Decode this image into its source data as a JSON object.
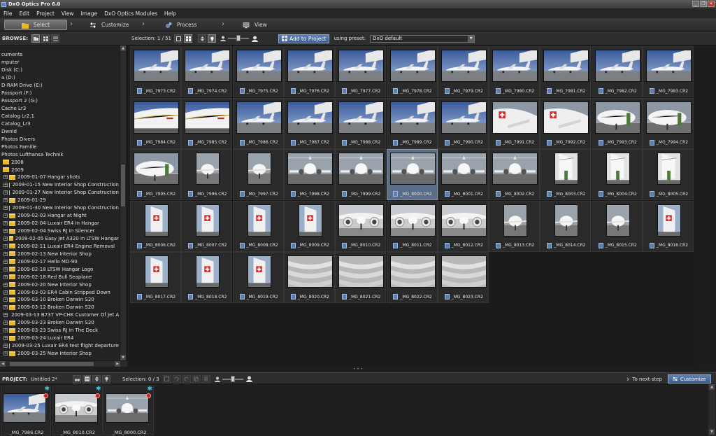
{
  "window": {
    "title": "DxO Optics Pro 6.0"
  },
  "menu": [
    "File",
    "Edit",
    "Project",
    "View",
    "Image",
    "DxO Optics Modules",
    "Help"
  ],
  "steps": [
    {
      "label": "Select",
      "icon": "folder-icon"
    },
    {
      "label": "Customize",
      "icon": "sliders-icon"
    },
    {
      "label": "Process",
      "icon": "gears-icon"
    },
    {
      "label": "View",
      "icon": "monitor-icon"
    }
  ],
  "toolbar": {
    "browse_label": "BROWSE:",
    "selection": "Selection: 1 / 51",
    "add_button": "Add to Project",
    "preset_label": "using preset:",
    "preset_value": "DxO default"
  },
  "browser": {
    "nodes": [
      {
        "label": "cuments",
        "type": "text"
      },
      {
        "label": "mputer",
        "type": "text"
      },
      {
        "label": "Disk (C:)",
        "type": "text"
      },
      {
        "label": "a (D:)",
        "type": "text"
      },
      {
        "label": "D-RAM Drive (E:)",
        "type": "text"
      },
      {
        "label": "Passport (F:)",
        "type": "text"
      },
      {
        "label": "Passport 2 (G:)",
        "type": "text"
      },
      {
        "label": "Cache Lr3",
        "type": "text"
      },
      {
        "label": "Catalog Lr2.1",
        "type": "text"
      },
      {
        "label": "Catalog_Lr3",
        "type": "text"
      },
      {
        "label": "Dwnld",
        "type": "text"
      },
      {
        "label": "Photos Divers",
        "type": "text"
      },
      {
        "label": "Photos Famille",
        "type": "text"
      },
      {
        "label": "Photos Lufthansa Technik",
        "type": "text"
      },
      {
        "label": "2008",
        "type": "folder"
      },
      {
        "label": "2009",
        "type": "folder"
      },
      {
        "label": "2009-01-07 Hangar shots",
        "type": "sub"
      },
      {
        "label": "2009-01-15 New Interior Shop Construction",
        "type": "sub"
      },
      {
        "label": "2009-01-27 New Interior Shop Construction",
        "type": "sub"
      },
      {
        "label": "2009-01-29",
        "type": "sub"
      },
      {
        "label": "2009-01-30 New Interior Shop Construction",
        "type": "sub"
      },
      {
        "label": "2009-02-03 Hangar at Night",
        "type": "sub"
      },
      {
        "label": "2009-02-04 Luxair ER4 In Hangar",
        "type": "sub"
      },
      {
        "label": "2009-02-04 Swiss RJ In Silencer",
        "type": "sub"
      },
      {
        "label": "2009-02-05 Easy Jet A320 in LTSW Hangar",
        "type": "sub"
      },
      {
        "label": "2009-02-11 Luxair ER4 Engine Removal",
        "type": "sub"
      },
      {
        "label": "2009-02-13 New Interior Shop",
        "type": "sub"
      },
      {
        "label": "2009-02-17 Hello MD-90",
        "type": "sub"
      },
      {
        "label": "2009-02-18 LTSW Hangar Logo",
        "type": "sub"
      },
      {
        "label": "2009-02-18 Red Bull Seaplane",
        "type": "sub"
      },
      {
        "label": "2009-02-20 New Interior Shop",
        "type": "sub"
      },
      {
        "label": "2009-03-03 ER4 Cabin Stripped Down",
        "type": "sub"
      },
      {
        "label": "2009-03-10 Broken Darwin S20",
        "type": "sub"
      },
      {
        "label": "2009-03-12 Broken Darwin S20",
        "type": "sub"
      },
      {
        "label": "2009-03-13 B737 VP-CHK Customer Of Jet A",
        "type": "sub"
      },
      {
        "label": "2009-03-23 Broken Darwin S20",
        "type": "sub"
      },
      {
        "label": "2009-03-23 Swiss RJ In The Dock",
        "type": "sub"
      },
      {
        "label": "2009-03-24 Luxair ER4",
        "type": "sub"
      },
      {
        "label": "2009-03-25 Luxair ER4 test flight departure",
        "type": "sub"
      },
      {
        "label": "2009-03-25 New Interior Shop",
        "type": "sub"
      }
    ]
  },
  "thumbnails": [
    {
      "name": "_MG_7973.CR2",
      "kind": "plane-wide"
    },
    {
      "name": "_MG_7974.CR2",
      "kind": "plane-wide"
    },
    {
      "name": "_MG_7975.CR2",
      "kind": "plane-wide"
    },
    {
      "name": "_MG_7976.CR2",
      "kind": "plane-wide"
    },
    {
      "name": "_MG_7977.CR2",
      "kind": "plane-wide"
    },
    {
      "name": "_MG_7978.CR2",
      "kind": "plane-wide"
    },
    {
      "name": "_MG_7979.CR2",
      "kind": "plane-wide"
    },
    {
      "name": "_MG_7980.CR2",
      "kind": "plane-wide"
    },
    {
      "name": "_MG_7981.CR2",
      "kind": "plane-wide"
    },
    {
      "name": "_MG_7982.CR2",
      "kind": "plane-wide"
    },
    {
      "name": "_MG_7983.CR2",
      "kind": "plane-wide"
    },
    {
      "name": "_MG_7984.CR2",
      "kind": "fuselage"
    },
    {
      "name": "_MG_7985.CR2",
      "kind": "fuselage"
    },
    {
      "name": "_MG_7986.CR2",
      "kind": "plane-wide"
    },
    {
      "name": "_MG_7987.CR2",
      "kind": "plane-wide"
    },
    {
      "name": "_MG_7988.CR2",
      "kind": "plane-wide"
    },
    {
      "name": "_MG_7989.CR2",
      "kind": "plane-wide"
    },
    {
      "name": "_MG_7990.CR2",
      "kind": "plane-wide"
    },
    {
      "name": "_MG_7991.CR2",
      "kind": "swiss-hangar"
    },
    {
      "name": "_MG_7992.CR2",
      "kind": "swiss-hangar"
    },
    {
      "name": "_MG_7993.CR2",
      "kind": "nose"
    },
    {
      "name": "_MG_7994.CR2",
      "kind": "nose"
    },
    {
      "name": "_MG_7995.CR2",
      "kind": "nose"
    },
    {
      "name": "_MG_7996.CR2",
      "kind": "nose-portrait"
    },
    {
      "name": "_MG_7997.CR2",
      "kind": "nose-portrait"
    },
    {
      "name": "_MG_7998.CR2",
      "kind": "front"
    },
    {
      "name": "_MG_7999.CR2",
      "kind": "front"
    },
    {
      "name": "_MG_8000.CR2",
      "kind": "front",
      "selected": true
    },
    {
      "name": "_MG_8001.CR2",
      "kind": "front"
    },
    {
      "name": "_MG_8002.CR2",
      "kind": "front"
    },
    {
      "name": "_MG_8003.CR2",
      "kind": "wing-portrait"
    },
    {
      "name": "_MG_8004.CR2",
      "kind": "wing-portrait"
    },
    {
      "name": "_MG_8005.CR2",
      "kind": "wing-portrait"
    },
    {
      "name": "_MG_8006.CR2",
      "kind": "tail-portrait"
    },
    {
      "name": "_MG_8007.CR2",
      "kind": "tail-portrait"
    },
    {
      "name": "_MG_8008.CR2",
      "kind": "tail-portrait"
    },
    {
      "name": "_MG_8009.CR2",
      "kind": "tail-portrait"
    },
    {
      "name": "_MG_8010.CR2",
      "kind": "engines"
    },
    {
      "name": "_MG_8011.CR2",
      "kind": "engines"
    },
    {
      "name": "_MG_8012.CR2",
      "kind": "engines"
    },
    {
      "name": "_MG_8013.CR2",
      "kind": "nose-portrait"
    },
    {
      "name": "_MG_8014.CR2",
      "kind": "nose-portrait"
    },
    {
      "name": "_MG_8015.CR2",
      "kind": "nose-portrait"
    },
    {
      "name": "_MG_8016.CR2",
      "kind": "tail-portrait"
    },
    {
      "name": "_MG_8017.CR2",
      "kind": "tail-portrait"
    },
    {
      "name": "_MG_8018.CR2",
      "kind": "tail-portrait"
    },
    {
      "name": "_MG_8019.CR2",
      "kind": "tail-portrait"
    },
    {
      "name": "_MG_8020.CR2",
      "kind": "blur"
    },
    {
      "name": "_MG_8021.CR2",
      "kind": "blur"
    },
    {
      "name": "_MG_8022.CR2",
      "kind": "blur"
    },
    {
      "name": "_MG_8023.CR2",
      "kind": "blur"
    }
  ],
  "project": {
    "label": "PROJECT:",
    "name": "Untitled 2*",
    "selection": "Selection: 0 / 3",
    "next_label": "To next step",
    "next_button": "Customize",
    "items": [
      {
        "name": "_MG_7986.CR2",
        "kind": "plane-wide"
      },
      {
        "name": "_MG_8010.CR2",
        "kind": "engines"
      },
      {
        "name": "_MG_8000.CR2",
        "kind": "front"
      }
    ]
  },
  "colors": {
    "accent": "#4a6ea5",
    "selection": "#5a6e8a",
    "folder": "#e7b933",
    "status_star": "#38c0ee",
    "status_dot": "#c81e1e"
  }
}
